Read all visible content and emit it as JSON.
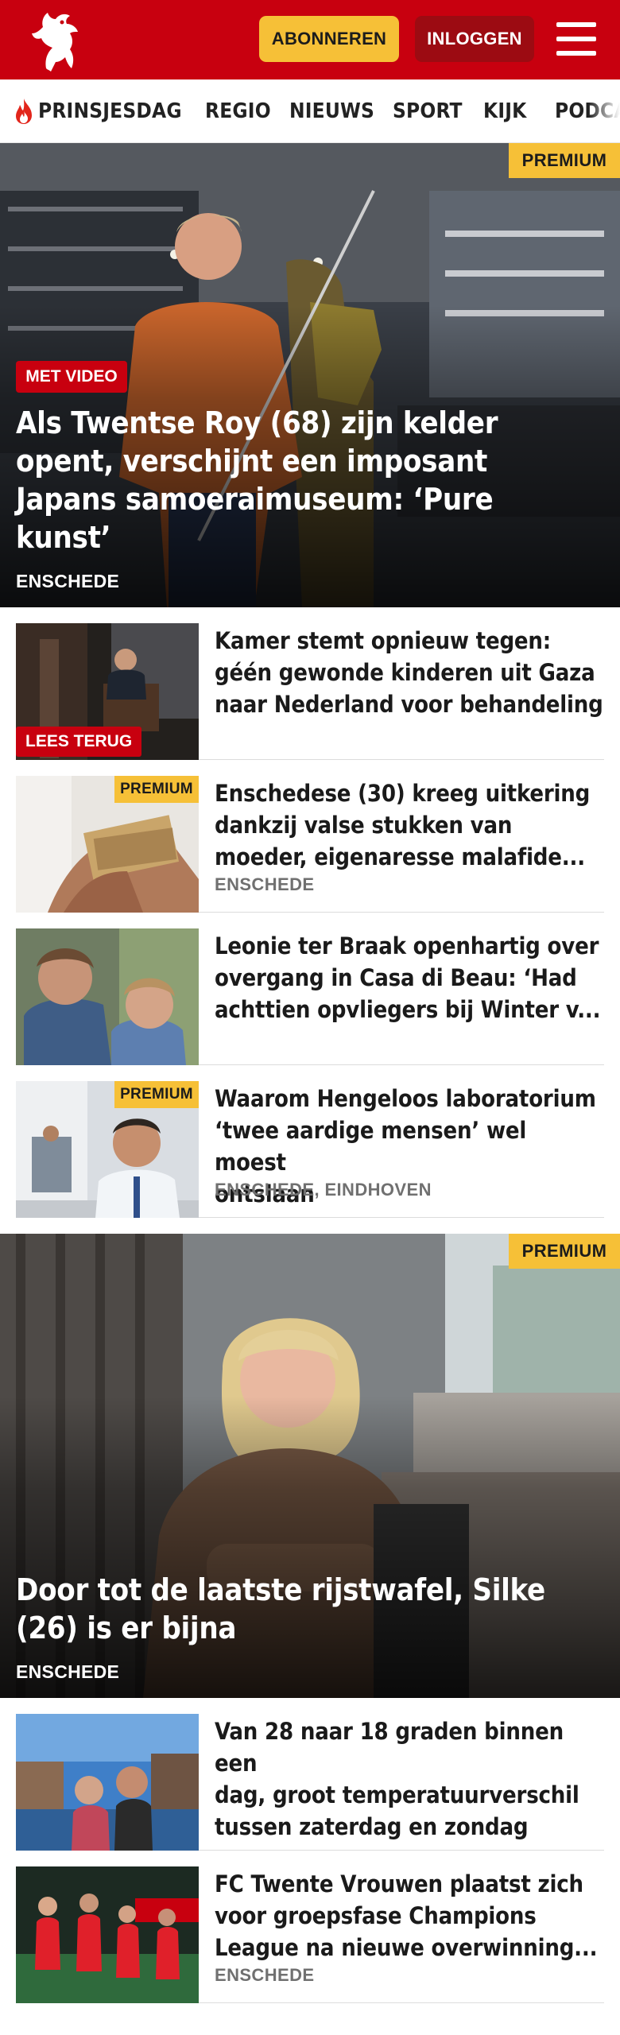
{
  "header": {
    "subscribe_label": "ABONNEREN",
    "login_label": "INLOGGEN",
    "brand_color": "#c8000f",
    "accent_color": "#f6c037"
  },
  "nav": {
    "items": [
      {
        "label": "PRINSJESDAG",
        "icon": "flame-icon"
      },
      {
        "label": "REGIO"
      },
      {
        "label": "NIEUWS"
      },
      {
        "label": "SPORT"
      },
      {
        "label": "KIJK"
      },
      {
        "label": "PODCA"
      }
    ]
  },
  "hero1": {
    "premium": "PREMIUM",
    "video_tag": "MET VIDEO",
    "title_lines": [
      "Als Twentse Roy (68) zijn kelder",
      "opent, verschijnt een imposant",
      "Japans samoeraimuseum: ‘Pure",
      "kunst’"
    ],
    "kicker": "ENSCHEDE"
  },
  "list1": [
    {
      "title_lines": [
        "Kamer stemt opnieuw tegen:",
        "géén gewonde kinderen uit Gaza",
        "naar Nederland voor behandeling"
      ],
      "badge": "LEES TERUG",
      "kicker": ""
    },
    {
      "title_lines": [
        "Enschedese (30) kreeg uitkering",
        "dankzij valse stukken van",
        "moeder, eigenaresse malafide..."
      ],
      "premium": "PREMIUM",
      "kicker": "ENSCHEDE"
    },
    {
      "title_lines": [
        "Leonie ter Braak openhartig over",
        "overgang in Casa di Beau: ‘Had",
        "achttien opvliegers bij Winter v..."
      ],
      "kicker": ""
    },
    {
      "title_lines": [
        "Waarom Hengeloos laboratorium",
        "‘twee aardige mensen’ wel moest",
        "ontslaan"
      ],
      "premium": "PREMIUM",
      "kicker": "ENSCHEDE, EINDHOVEN"
    }
  ],
  "hero2": {
    "premium": "PREMIUM",
    "title_lines": [
      "Door tot de laatste rijstwafel, Silke",
      "(26) is er bijna"
    ],
    "kicker": "ENSCHEDE"
  },
  "list2": [
    {
      "title_lines": [
        "Van 28 naar 18 graden binnen een",
        "dag, groot temperatuurverschil",
        "tussen zaterdag en zondag"
      ],
      "kicker": ""
    },
    {
      "title_lines": [
        "FC Twente Vrouwen plaatst zich",
        "voor groepsfase Champions",
        "League na nieuwe overwinning..."
      ],
      "kicker": "ENSCHEDE"
    }
  ]
}
